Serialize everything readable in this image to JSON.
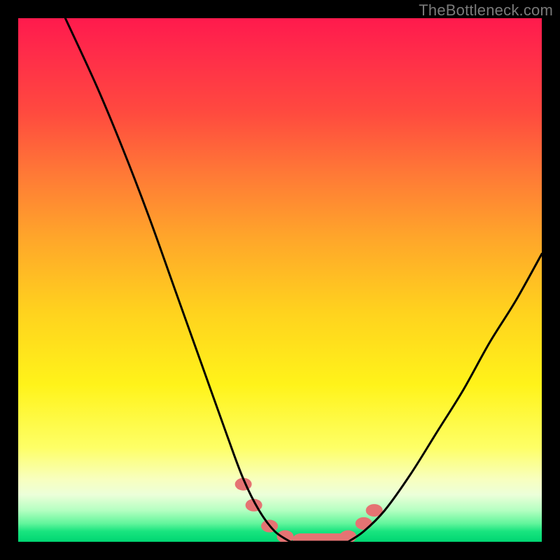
{
  "watermark": "TheBottleneck.com",
  "chart_data": {
    "type": "line",
    "title": "",
    "xlabel": "",
    "ylabel": "",
    "xlim": [
      0,
      100
    ],
    "ylim": [
      0,
      100
    ],
    "grid": false,
    "series": [
      {
        "name": "left-curve",
        "x": [
          9,
          15,
          20,
          25,
          30,
          35,
          40,
          43,
          46,
          49,
          52
        ],
        "y": [
          100,
          87,
          75,
          62,
          48,
          34,
          20,
          12,
          6,
          2,
          0
        ]
      },
      {
        "name": "right-curve",
        "x": [
          63,
          66,
          70,
          75,
          80,
          85,
          90,
          95,
          100
        ],
        "y": [
          0,
          2,
          6,
          13,
          21,
          29,
          38,
          46,
          55
        ]
      },
      {
        "name": "valley-floor",
        "x": [
          52,
          55,
          58,
          61,
          63
        ],
        "y": [
          0,
          0,
          0,
          0,
          0
        ]
      }
    ],
    "markers": {
      "name": "highlighted-points",
      "color": "#e57373",
      "points": [
        {
          "x": 43,
          "y": 11
        },
        {
          "x": 45,
          "y": 7
        },
        {
          "x": 48,
          "y": 3
        },
        {
          "x": 51,
          "y": 1
        },
        {
          "x": 54,
          "y": 0.4
        },
        {
          "x": 57,
          "y": 0.4
        },
        {
          "x": 60,
          "y": 0.4
        },
        {
          "x": 63,
          "y": 1
        },
        {
          "x": 66,
          "y": 3.5
        },
        {
          "x": 68,
          "y": 6
        }
      ]
    },
    "gradient_stops": [
      {
        "pct": 0,
        "color": "#ff1a4d"
      },
      {
        "pct": 18,
        "color": "#ff4a3f"
      },
      {
        "pct": 42,
        "color": "#ffa62a"
      },
      {
        "pct": 70,
        "color": "#fff31a"
      },
      {
        "pct": 88,
        "color": "#f8ffbe"
      },
      {
        "pct": 96,
        "color": "#62f59c"
      },
      {
        "pct": 100,
        "color": "#00d672"
      }
    ]
  }
}
